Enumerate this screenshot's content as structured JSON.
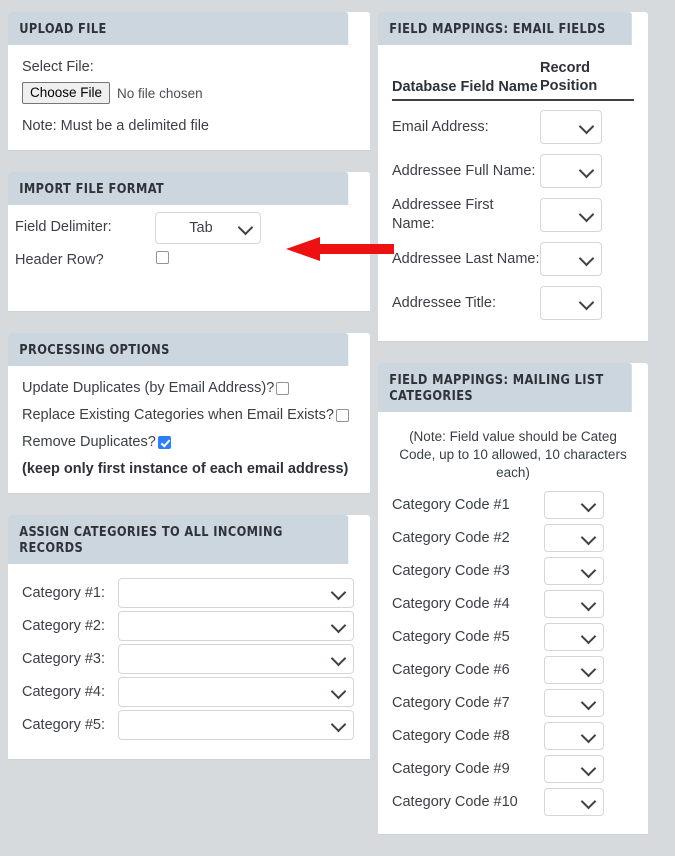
{
  "upload_file": {
    "title": "Upload File",
    "select_file_label": "Select File:",
    "choose_file_button": "Choose File",
    "file_status": "No file chosen",
    "note": "Note: Must be a delimited file"
  },
  "import_file_format": {
    "title": "Import File Format",
    "field_delimiter_label": "Field Delimiter:",
    "field_delimiter_value": "Tab",
    "header_row_label": "Header Row?",
    "header_row_checked": false
  },
  "processing_options": {
    "title": "Processing Options",
    "options": [
      {
        "label": "Update Duplicates (by Email Address)?",
        "checked": false
      },
      {
        "label": "Replace Existing Categories when Email Exists?",
        "checked": false
      },
      {
        "label": "Remove Duplicates?",
        "checked": true
      }
    ],
    "note": "(keep only first instance of each email address)"
  },
  "assign_categories": {
    "title": "Assign Categories to all Incoming Records",
    "rows": [
      {
        "label": "Category #1:",
        "value": ""
      },
      {
        "label": "Category #2:",
        "value": ""
      },
      {
        "label": "Category #3:",
        "value": ""
      },
      {
        "label": "Category #4:",
        "value": ""
      },
      {
        "label": "Category #5:",
        "value": ""
      }
    ]
  },
  "field_mappings_email": {
    "title": "Field Mappings: Email Fields",
    "col_field_name": "Database Field Name",
    "col_record_position": "Record Position",
    "rows": [
      {
        "label": "Email Address:",
        "value": ""
      },
      {
        "label": "Addressee Full Name:",
        "value": ""
      },
      {
        "label": "Addressee First Name:",
        "value": ""
      },
      {
        "label": "Addressee Last Name:",
        "value": ""
      },
      {
        "label": "Addressee Title:",
        "value": ""
      }
    ]
  },
  "field_mappings_categories": {
    "title": "Field Mappings: Mailing List Categories",
    "note": "(Note: Field value should be Categ Code, up to 10 allowed, 10 characters each)",
    "rows": [
      {
        "label": "Category Code #1",
        "value": ""
      },
      {
        "label": "Category Code #2",
        "value": ""
      },
      {
        "label": "Category Code #3",
        "value": ""
      },
      {
        "label": "Category Code #4",
        "value": ""
      },
      {
        "label": "Category Code #5",
        "value": ""
      },
      {
        "label": "Category Code #6",
        "value": ""
      },
      {
        "label": "Category Code #7",
        "value": ""
      },
      {
        "label": "Category Code #8",
        "value": ""
      },
      {
        "label": "Category Code #9",
        "value": ""
      },
      {
        "label": "Category Code #10",
        "value": ""
      }
    ]
  },
  "annotation": {
    "arrow_color": "#ee1111",
    "arrow_direction": "left",
    "points_at": "field-delimiter-select"
  },
  "colors": {
    "page_background": "#d6dadd",
    "panel_header": "#ccd6de",
    "panel_body": "#ffffff",
    "text": "#3a4046",
    "checkbox_checked": "#2b7fff",
    "annotation_red": "#ee1111"
  }
}
